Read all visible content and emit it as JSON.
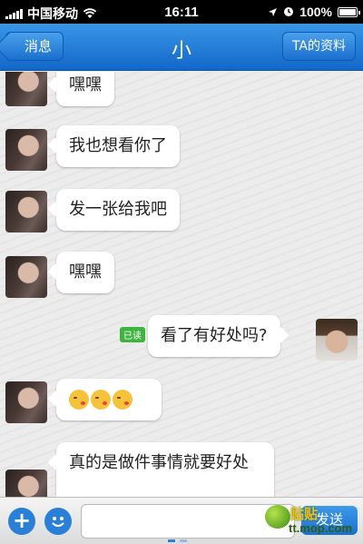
{
  "status_bar": {
    "carrier": "中国移动",
    "time": "16:11",
    "battery": "100%"
  },
  "nav": {
    "back_label": "消息",
    "title": "小",
    "profile_label": "TA的资料"
  },
  "messages": [
    {
      "side": "left",
      "text": "嘿嘿"
    },
    {
      "side": "left",
      "text": "我也想看你了"
    },
    {
      "side": "left",
      "text": "发一张给我吧"
    },
    {
      "side": "left",
      "text": "嘿嘿"
    },
    {
      "side": "right",
      "text": "看了有好处吗?",
      "read_badge": "已读"
    },
    {
      "side": "left",
      "emoji": [
        "kissing-face",
        "kissing-face",
        "kissing-face"
      ]
    },
    {
      "side": "left",
      "text": "真的是做件事情就要好处"
    }
  ],
  "input_bar": {
    "placeholder": "",
    "send_label": "发送"
  },
  "watermark": {
    "brand": "贴贴",
    "url": "tt.mop.com"
  },
  "colors": {
    "nav_blue": "#1a6fcd",
    "read_badge_green": "#3fb33f"
  }
}
